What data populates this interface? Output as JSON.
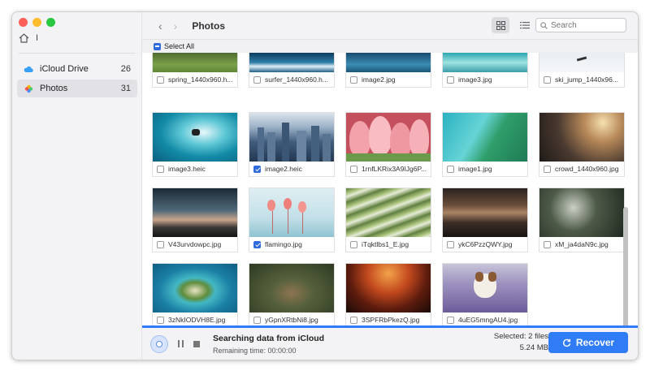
{
  "sidebar": {
    "path_text": "I",
    "items": [
      {
        "label": "iCloud Drive",
        "count": "26"
      },
      {
        "label": "Photos",
        "count": "31"
      }
    ]
  },
  "header": {
    "title": "Photos",
    "search_placeholder": "Search"
  },
  "select_all_label": "Select All",
  "grid": {
    "top_row": [
      "spring_1440x960.h...",
      "surfer_1440x960.h...",
      "image2.jpg",
      "image3.jpg",
      "ski_jump_1440x96..."
    ],
    "rows": [
      [
        {
          "name": "image3.heic",
          "checked": false
        },
        {
          "name": "image2.heic",
          "checked": true
        },
        {
          "name": "1rnfLKRix3A9IJg6P...",
          "checked": false
        },
        {
          "name": "image1.jpg",
          "checked": false
        },
        {
          "name": "crowd_1440x960.jpg",
          "checked": false
        }
      ],
      [
        {
          "name": "V43urvdowpc.jpg",
          "checked": false
        },
        {
          "name": "flamingo.jpg",
          "checked": true
        },
        {
          "name": "iTqktlbs1_E.jpg",
          "checked": false
        },
        {
          "name": "ykC6PzzQWY.jpg",
          "checked": false
        },
        {
          "name": "xM_ja4daN9c.jpg",
          "checked": false
        }
      ],
      [
        {
          "name": "3zNkIODVH8E.jpg",
          "checked": false
        },
        {
          "name": "yGpnXRtbNi8.jpg",
          "checked": false
        },
        {
          "name": "3SPFRbPkezQ.jpg",
          "checked": false
        },
        {
          "name": "4uEG5mngAU4.jpg",
          "checked": false
        }
      ]
    ]
  },
  "footer": {
    "status_title": "Searching data from iCloud",
    "remaining": "Remaining time: 00:00:00",
    "selected": "Selected: 2 files",
    "size": "5.24 MB",
    "recover_label": "Recover"
  },
  "colors": {
    "accent": "#2f7cf6",
    "checkbox_blue": "#2f6bdc"
  }
}
